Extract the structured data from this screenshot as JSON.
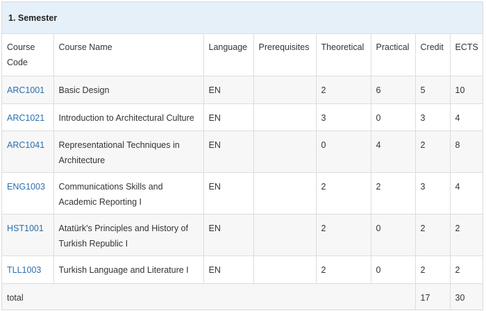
{
  "semester": {
    "title": "1. Semester"
  },
  "columns": [
    "Course Code",
    "Course Name",
    "Language",
    "Prerequisites",
    "Theoretical",
    "Practical",
    "Credit",
    "ECTS"
  ],
  "rows": [
    {
      "code": "ARC1001",
      "name": "Basic Design",
      "language": "EN",
      "prerequisites": "",
      "theoretical": "2",
      "practical": "6",
      "credit": "5",
      "ects": "10"
    },
    {
      "code": "ARC1021",
      "name": "Introduction to Architectural Culture",
      "language": "EN",
      "prerequisites": "",
      "theoretical": "3",
      "practical": "0",
      "credit": "3",
      "ects": "4"
    },
    {
      "code": "ARC1041",
      "name": "Representational Techniques in Architecture",
      "language": "EN",
      "prerequisites": "",
      "theoretical": "0",
      "practical": "4",
      "credit": "2",
      "ects": "8"
    },
    {
      "code": "ENG1003",
      "name": "Communications Skills and Academic Reporting I",
      "language": "EN",
      "prerequisites": "",
      "theoretical": "2",
      "practical": "2",
      "credit": "3",
      "ects": "4"
    },
    {
      "code": "HST1001",
      "name": "Atatürk's Principles and History of Turkish Republic I",
      "language": "EN",
      "prerequisites": "",
      "theoretical": "2",
      "practical": "0",
      "credit": "2",
      "ects": "2"
    },
    {
      "code": "TLL1003",
      "name": "Turkish Language and Literature I",
      "language": "EN",
      "prerequisites": "",
      "theoretical": "2",
      "practical": "0",
      "credit": "2",
      "ects": "2"
    }
  ],
  "total": {
    "label": "total",
    "credit": "17",
    "ects": "30"
  },
  "colors": {
    "heading_bg": "#e6f0f8",
    "link": "#2a6fb0",
    "stripe": "#f7f7f7",
    "border": "#dddddd"
  }
}
